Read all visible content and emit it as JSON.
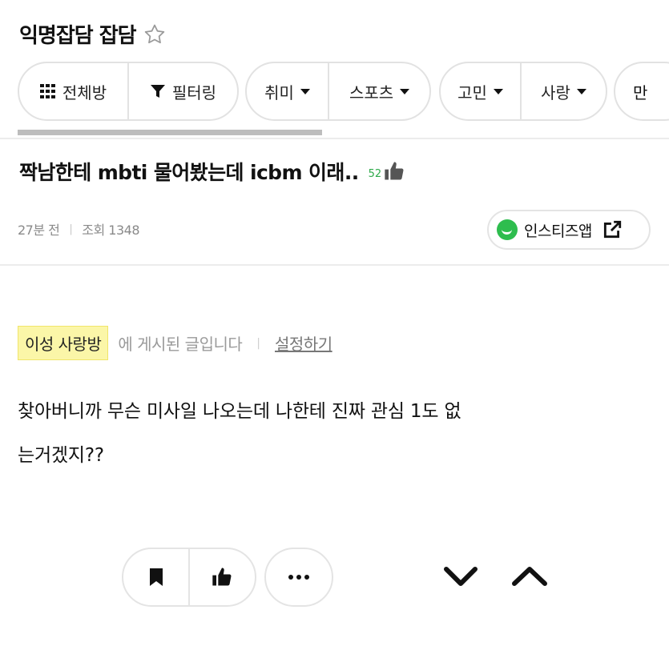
{
  "board": {
    "title": "익명잡담 잡담",
    "favorite_icon": "star-outline-icon"
  },
  "filters": {
    "all_rooms": "전체방",
    "filtering": "필터링",
    "categories": [
      {
        "label": "취미"
      },
      {
        "label": "스포츠"
      },
      {
        "label": "고민"
      },
      {
        "label": "사랑"
      },
      {
        "label": "만"
      }
    ]
  },
  "post": {
    "title": "짝남한테 mbti 물어봤는데 icbm 이래..",
    "like_count": "52",
    "time": "27분 전",
    "views": "조회 1348",
    "app_button": "인스티즈앱",
    "board_tag": "이성 사랑방",
    "board_tag_suffix": "에 게시된 글입니다",
    "settings_link": "설정하기",
    "body_line1": "찾아버니까 무슨 미사일 나오는데 나한테 진짜 관심 1도 없",
    "body_line2": "는거겠지??"
  },
  "colors": {
    "accent_green": "#2ebd4e",
    "tag_yellow": "#fbf6a8",
    "meta_gray": "#8a8a8a"
  }
}
